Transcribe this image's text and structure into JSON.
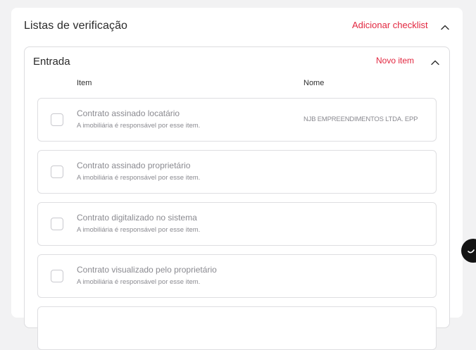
{
  "checklists": {
    "title": "Listas de verificação",
    "add_label": "Adicionar checklist"
  },
  "section": {
    "title": "Entrada",
    "new_item_label": "Novo item",
    "columns": {
      "item": "Item",
      "name": "Nome"
    },
    "rows": [
      {
        "title": "Contrato assinado locatário",
        "subtitle": "A imobiliária é responsável por esse item.",
        "name": "NJB EMPREENDIMENTOS LTDA. EPP"
      },
      {
        "title": "Contrato assinado proprietário",
        "subtitle": "A imobiliária é responsável por esse item.",
        "name": ""
      },
      {
        "title": "Contrato digitalizado no sistema",
        "subtitle": "A imobiliária é responsável por esse item.",
        "name": ""
      },
      {
        "title": "Contrato visualizado pelo proprietário",
        "subtitle": "A imobiliária é responsável por esse item.",
        "name": ""
      }
    ]
  },
  "colors": {
    "accent": "#e2263f",
    "muted_text": "#8a8a90",
    "border": "#dedee1"
  },
  "icons": {
    "collapse": "chevron-up-icon",
    "chat": "chat-bubble-icon"
  }
}
